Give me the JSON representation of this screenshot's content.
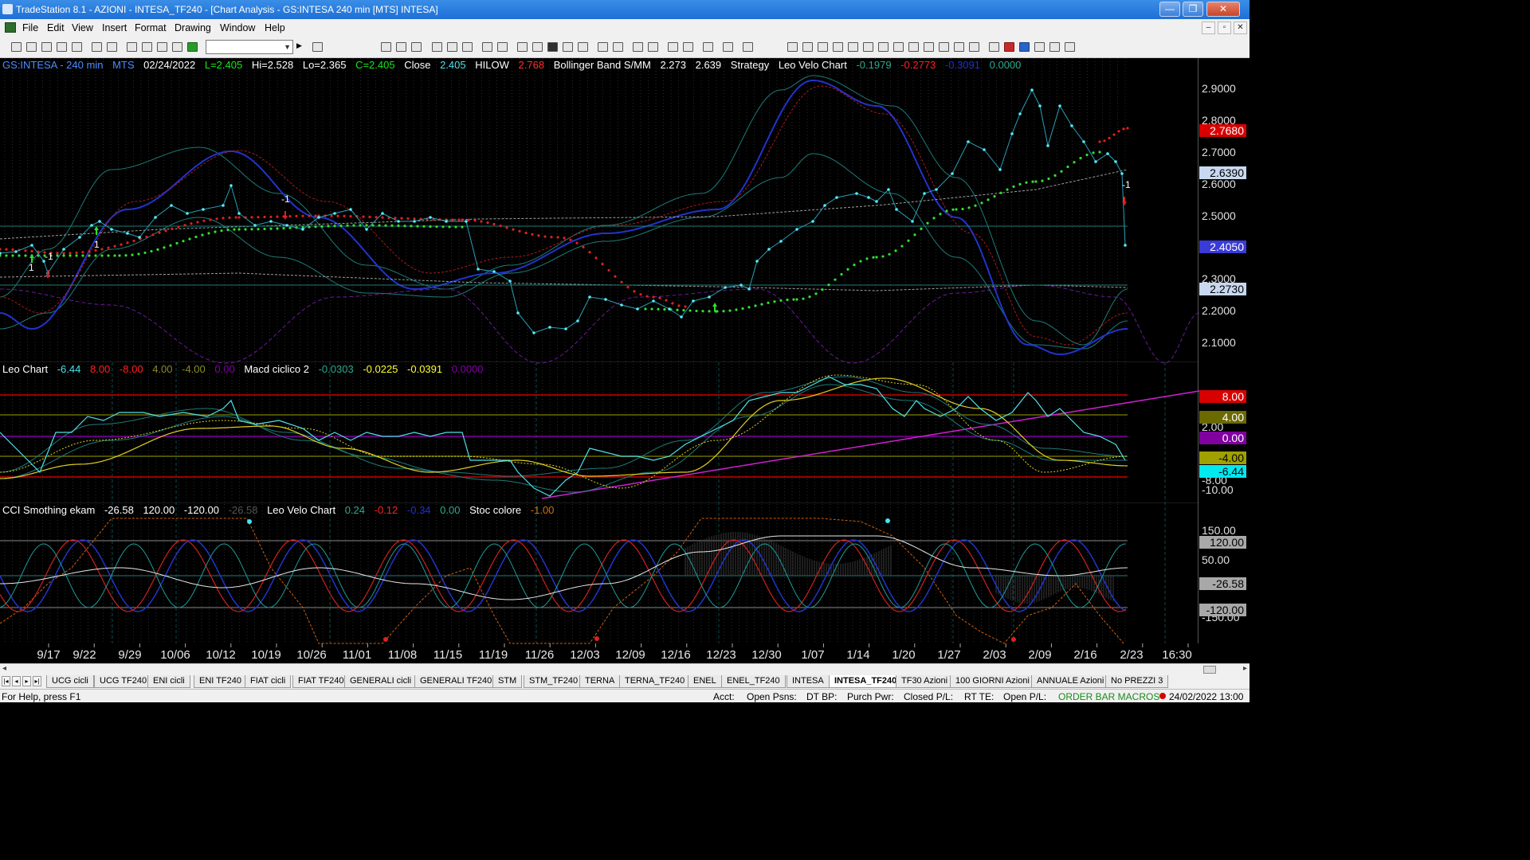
{
  "window": {
    "title": "TradeStation 8.1 - AZIONI - INTESA_TF240 - [Chart Analysis - GS:INTESA  240 min  [MTS] INTESA]",
    "min": "—",
    "max": "❐",
    "close": "✕"
  },
  "menu": {
    "items": [
      "File",
      "Edit",
      "View",
      "Insert",
      "Format",
      "Drawing",
      "Window",
      "Help"
    ],
    "mdi_min": "–",
    "mdi_restore": "▫",
    "mdi_close": "✕"
  },
  "toolbar": {
    "symbol_value": "",
    "dropdown_arrow": "▼",
    "play_arrow": "▶"
  },
  "chart": {
    "header": {
      "symbol": "GS:INTESA - 240 min",
      "mts": "MTS",
      "date": "02/24/2022",
      "low_first": "L=2.405",
      "high": "Hi=2.528",
      "low": "Lo=2.365",
      "close": "C=2.405",
      "close_label": "Close",
      "close_value": "2.405",
      "hilow_label": "HILOW",
      "hilow_value": "2.768",
      "bb_label": "Bollinger Band S/MM",
      "bb_v1": "2.273",
      "bb_v2": "2.639",
      "strategy": "Strategy",
      "leo_velo": "Leo Velo Chart",
      "lv1": "-0.1979",
      "lv2": "-0.2773",
      "lv3": "-0.3091",
      "lv4": "0.0000"
    },
    "price_axis": {
      "ticks": [
        "2.9000",
        "2.8000",
        "2.7000",
        "2.6000",
        "2.5000",
        "2.3000",
        "2.2000",
        "2.1000"
      ],
      "labels": [
        {
          "text": "2.7680",
          "bg": "#d80000",
          "fg": "#ffffff"
        },
        {
          "text": "2.6390",
          "bg": "#c8d8f0",
          "fg": "#000000"
        },
        {
          "text": "2.4050",
          "bg": "#3a3ad8",
          "fg": "#ffffff"
        },
        {
          "text": "2.2730",
          "bg": "#c8d8f0",
          "fg": "#000000"
        }
      ]
    },
    "panel2": {
      "header": {
        "name": "Leo Chart",
        "v1": "-6.44",
        "v2": "8.00",
        "v3": "-8.00",
        "v4": "4.00",
        "v5": "-4.00",
        "v6": "0.00",
        "name2": "Macd ciclico 2",
        "m1": "-0.0303",
        "m2": "-0.0225",
        "m3": "-0.0391",
        "m4": "0.0000"
      },
      "ticks": [
        "2.00",
        "-8.00",
        "-10.00"
      ],
      "labels": [
        {
          "text": "8.00",
          "bg": "#d80000",
          "fg": "#ffffff"
        },
        {
          "text": "4.00",
          "bg": "#6a6a00",
          "fg": "#ffffff"
        },
        {
          "text": "0.00",
          "bg": "#8000a0",
          "fg": "#ffffff"
        },
        {
          "text": "-4.00",
          "bg": "#a0a000",
          "fg": "#000000"
        },
        {
          "text": "-6.44",
          "bg": "#00e8f0",
          "fg": "#000000"
        }
      ]
    },
    "panel3": {
      "header": {
        "name": "CCI Smothing ekam",
        "v1": "-26.58",
        "v2": "120.00",
        "v3": "-120.00",
        "v4": "-26.58",
        "name2": "Leo Velo Chart",
        "l1": "0.24",
        "l2": "-0.12",
        "l3": "-0.34",
        "l4": "0.00",
        "name3": "Stoc colore",
        "s1": "-1.00"
      },
      "ticks": [
        "150.00",
        "50.00",
        "-150.00"
      ],
      "labels": [
        {
          "text": "120.00",
          "bg": "#a8a8a8",
          "fg": "#000000"
        },
        {
          "text": "-26.58",
          "bg": "#a8a8a8",
          "fg": "#000000"
        },
        {
          "text": "-120.00",
          "bg": "#a8a8a8",
          "fg": "#000000"
        }
      ]
    },
    "date_axis": [
      "9/17",
      "9/22",
      "9/29",
      "10/06",
      "10/12",
      "10/19",
      "10/26",
      "11/01",
      "11/08",
      "11/15",
      "11/19",
      "11/26",
      "12/03",
      "12/09",
      "12/16",
      "12/23",
      "12/30",
      "1/07",
      "1/14",
      "1/20",
      "1/27",
      "2/03",
      "2/09",
      "2/16",
      "2/23",
      "16:30"
    ],
    "markers": {
      "up": "1",
      "down": "-1"
    }
  },
  "scroll": {
    "left": "◂",
    "right": "▸"
  },
  "tabs": [
    "UCG cicli",
    "UCG TF240",
    "ENI cicli",
    "ENI TF240",
    "FIAT cicli",
    "FIAT TF240",
    "GENERALI cicli",
    "GENERALI TF240",
    "STM",
    "STM_TF240",
    "TERNA",
    "TERNA_TF240",
    "ENEL",
    "ENEL_TF240",
    "INTESA",
    "INTESA_TF240",
    "TF30 Azioni",
    "100 GIORNI Azioni",
    "ANNUALE Azioni",
    "No PREZZI 3"
  ],
  "active_tab": "INTESA_TF240",
  "tab_nav": [
    "|◂",
    "◂",
    "▸",
    "▸|"
  ],
  "status": {
    "help": "For Help, press F1",
    "acct": "Acct:",
    "open_psns": "Open Psns:",
    "dt_bp": "DT BP:",
    "purch_pwr": "Purch Pwr:",
    "closed_pl": "Closed P/L:",
    "rt_te": "RT TE:",
    "open_pl": "Open P/L:",
    "macros": "ORDER BAR  MACROS",
    "datetime": "24/02/2022 13:00"
  }
}
